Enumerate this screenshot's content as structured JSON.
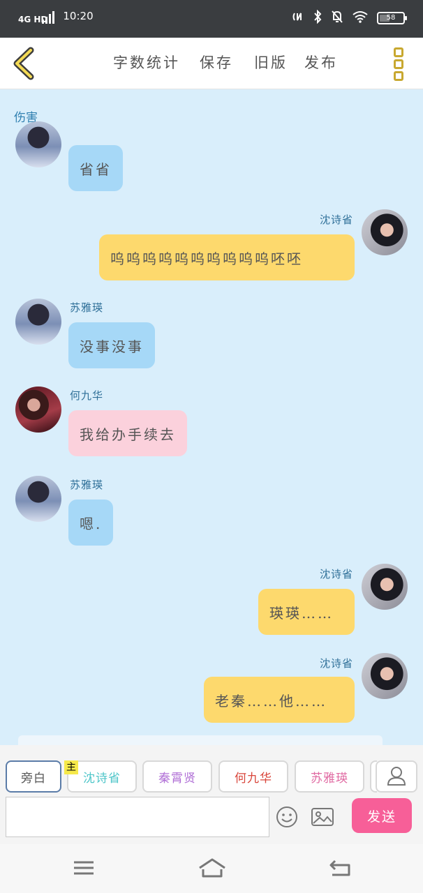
{
  "status_bar": {
    "network": "4G HD",
    "time": "10:20",
    "battery_label": "58"
  },
  "header": {
    "nav": [
      "字数统计",
      "保存",
      "旧版",
      "发布"
    ]
  },
  "chat": {
    "topic": "伤害",
    "messages": [
      {
        "name": "",
        "text": "省省",
        "color": "#a6d8f7"
      },
      {
        "name": "沈诗省",
        "text": "呜呜呜呜呜呜呜呜呜呜呸呸",
        "color": "#fdd96d"
      },
      {
        "name": "苏雅瑛",
        "text": "没事没事",
        "color": "#a6d8f7"
      },
      {
        "name": "何九华",
        "text": "我给办手续去",
        "color": "#fbd1dc"
      },
      {
        "name": "苏雅瑛",
        "text": "嗯.",
        "color": "#a6d8f7"
      },
      {
        "name": "沈诗省",
        "text": "瑛瑛……",
        "color": "#fdd96d"
      },
      {
        "name": "沈诗省",
        "text": "老秦……他……",
        "color": "#fdd96d"
      }
    ]
  },
  "composer": {
    "main_tag": "主",
    "roles": [
      {
        "label": "旁白",
        "color": "#555555"
      },
      {
        "label": "沈诗省",
        "color": "#4fc6c9"
      },
      {
        "label": "秦霄贤",
        "color": "#b06fd6"
      },
      {
        "label": "何九华",
        "color": "#d9463b"
      },
      {
        "label": "苏雅瑛",
        "color": "#e06aa2"
      }
    ],
    "send_label": "发送",
    "input_value": ""
  },
  "icons": {
    "back": "chevron-left-icon",
    "more": "more-vertical-icon",
    "emoji": "smiley-icon",
    "image": "image-icon",
    "person": "person-icon",
    "menu": "menu-icon",
    "home": "home-icon",
    "return": "return-icon"
  },
  "colors": {
    "chat_bg": "#d9eefb",
    "send_button": "#f75f98",
    "accent_yellow": "#c8a830"
  }
}
